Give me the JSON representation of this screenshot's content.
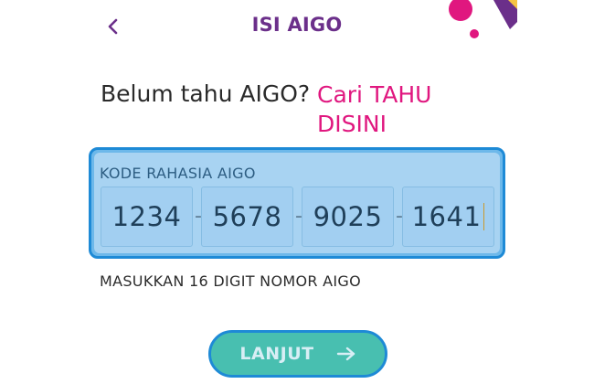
{
  "header": {
    "title": "ISI AIGO",
    "back_icon": "chevron-left-icon"
  },
  "prompt": {
    "question": "Belum tahu AIGO?",
    "link_text": "Cari TAHU DISINI"
  },
  "code_input": {
    "label": "KODE RAHASIA AIGO",
    "segments": [
      "1234",
      "5678",
      "9025",
      "1641"
    ],
    "separator": "-"
  },
  "hint": "MASUKKAN 16 DIGIT NOMOR AIGO",
  "submit": {
    "label": "LANJUT",
    "icon": "arrow-right-icon"
  },
  "colors": {
    "title": "#6b2f8a",
    "link": "#e0177f",
    "focus_border": "#1e8ad6",
    "button_fill": "#48bfb0"
  }
}
